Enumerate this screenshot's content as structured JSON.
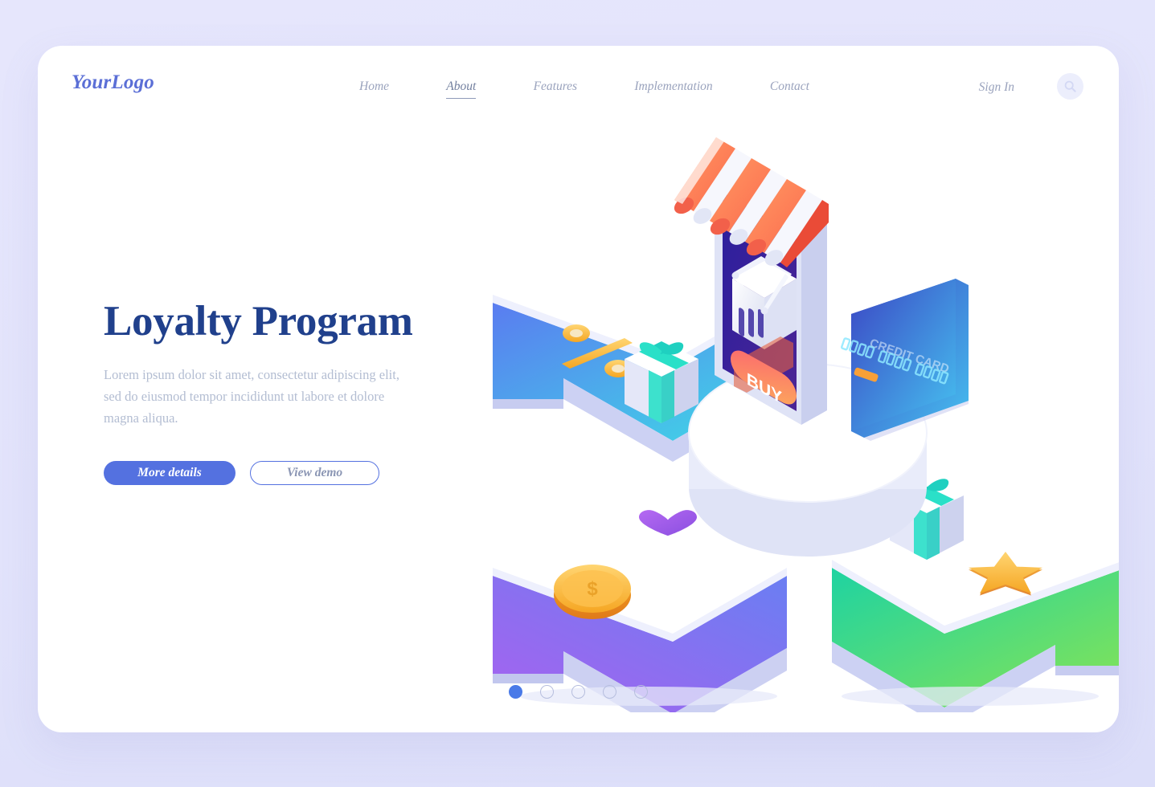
{
  "theme": {
    "page_bg": "#e3e4fb",
    "card_bg": "#ffffff",
    "brand_blue": "#5b6fd6",
    "heading_navy": "#20408c",
    "muted_text": "#b3bdd2",
    "nav_text": "#9aa3bd",
    "accent_button": "#5471e0",
    "dot_active": "#4a7ae8"
  },
  "header": {
    "logo": "YourLogo",
    "nav": [
      {
        "label": "Home",
        "active": false
      },
      {
        "label": "About",
        "active": true
      },
      {
        "label": "Features",
        "active": false
      },
      {
        "label": "Implementation",
        "active": false
      },
      {
        "label": "Contact",
        "active": false
      }
    ],
    "signin_label": "Sign In",
    "search_icon": "search-icon"
  },
  "hero": {
    "headline": "Loyalty Program",
    "paragraph": "Lorem ipsum dolor sit amet, consectetur adipiscing elit, sed do eiusmod tempor incididunt ut labore et dolore magna aliqua.",
    "primary_button": "More details",
    "secondary_button": "View demo"
  },
  "carousel": {
    "total_dots": 5,
    "active_index": 1,
    "dots": [
      {
        "index": 1,
        "active": true
      },
      {
        "index": 2,
        "active": false
      },
      {
        "index": 3,
        "active": false
      },
      {
        "index": 4,
        "active": false
      },
      {
        "index": 5,
        "active": false
      }
    ]
  },
  "illustration": {
    "name": "isometric-loyalty-program-illustration",
    "phone": {
      "screen_color": "#2e2193",
      "awning_colors": [
        "#ff8257",
        "#ffffff"
      ],
      "buy_button_label": "BUY",
      "basket_icon": "shopping-basket-icon"
    },
    "credit_card": {
      "title": "CREDIT CARD",
      "number": "0000 0000 0000",
      "gradient": [
        "#3b46c4",
        "#46c2f0"
      ],
      "chip_color": "#f9a037"
    },
    "arrows": [
      {
        "name": "arrow-top-left",
        "gradient": [
          "#5a7cf0",
          "#3edbe6"
        ],
        "items": [
          "percent-icon",
          "gift-box-icon"
        ]
      },
      {
        "name": "arrow-bottom-left",
        "gradient": [
          "#a762ef",
          "#6a7ef2"
        ],
        "items": [
          "dollar-coin-icon",
          "heart-icon"
        ]
      },
      {
        "name": "arrow-bottom-right",
        "gradient": [
          "#21d2a0",
          "#7ae04b"
        ],
        "items": [
          "gift-box-icon",
          "star-icon"
        ]
      }
    ],
    "pedestal": "white-cylinder-platform"
  }
}
